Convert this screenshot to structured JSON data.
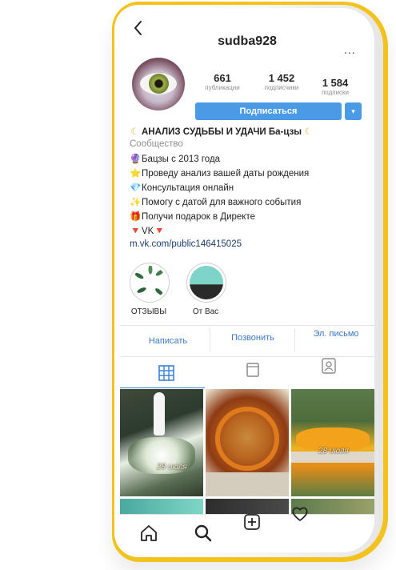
{
  "header": {
    "username": "sudba928",
    "more": "..."
  },
  "stats": [
    {
      "value": "661",
      "label": "публикации"
    },
    {
      "value": "1 452",
      "label": "подписчики"
    },
    {
      "value": "1 584",
      "label": "подписки"
    }
  ],
  "follow_label": "Подписаться",
  "dropdown_label": "▾",
  "bio": {
    "title": "АНАЛИЗ СУДЬБЫ И УДАЧИ Ба-цзы",
    "category": "Сообщество",
    "lines": [
      {
        "icon": "🔮",
        "text": "Бацзы с 2013 года"
      },
      {
        "icon": "⭐",
        "text": "Проведу анализ вашей даты рождения"
      },
      {
        "icon": "💎",
        "text": "Консультация онлайн"
      },
      {
        "icon": "✨",
        "text": "Помогу с датой для важного события"
      },
      {
        "icon": "🎁",
        "text": "Получи подарок в Директе"
      },
      {
        "icon": "🔻",
        "text": "VK🔻"
      }
    ],
    "link": "m.vk.com/public146415025"
  },
  "highlights": [
    {
      "label": "ОТЗЫВЫ"
    },
    {
      "label": "От Вас"
    }
  ],
  "actions": {
    "message": "Написать",
    "call": "Позвонить",
    "email": "Эл. письмо"
  },
  "posts": [
    {
      "caption": "28 июля"
    },
    {
      "caption": ""
    },
    {
      "caption": "28 июля"
    }
  ],
  "colors": {
    "accent": "#4a9ae6",
    "phone_frame": "#f4c21c",
    "link": "#3b78c2"
  }
}
